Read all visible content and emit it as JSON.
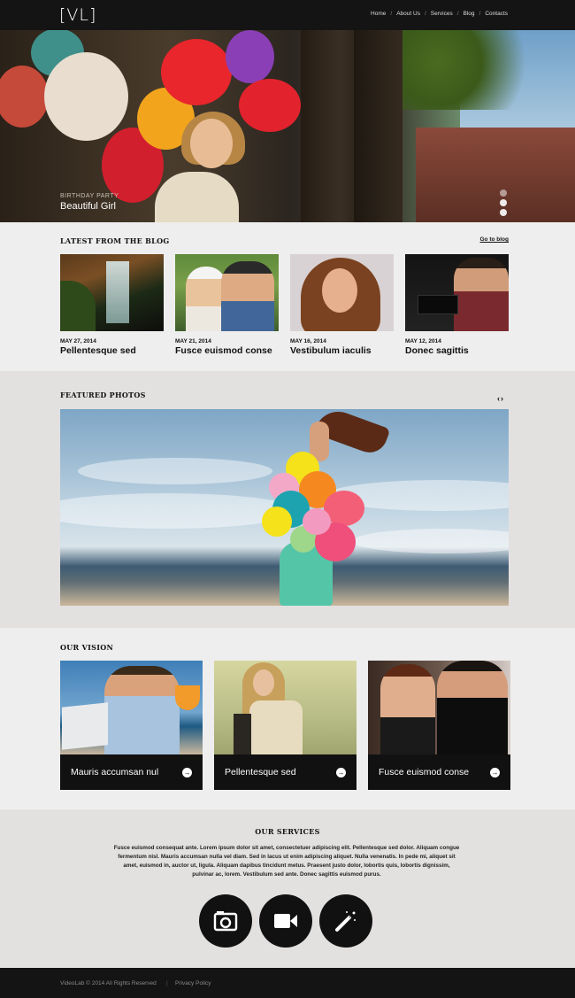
{
  "header": {
    "logo": "[VL]",
    "nav": [
      "Home",
      "About Us",
      "Services",
      "Blog",
      "Contacts"
    ]
  },
  "hero": {
    "caption_small": "BIRTHDAY PARTY",
    "caption_title": "Beautiful Girl",
    "slide_count": 3,
    "active_slide": 1
  },
  "blog": {
    "title": "LATEST FROM THE BLOG",
    "link": "Go to blog",
    "posts": [
      {
        "date": "MAY 27, 2014",
        "title": "Pellentesque sed"
      },
      {
        "date": "MAY 21, 2014",
        "title": "Fusce euismod conse"
      },
      {
        "date": "MAY 16, 2014",
        "title": "Vestibulum iaculis"
      },
      {
        "date": "MAY 12, 2014",
        "title": "Donec sagittis"
      }
    ]
  },
  "featured": {
    "title": "FEATURED PHOTOS",
    "prev": "‹",
    "next": "›"
  },
  "vision": {
    "title": "OUR VISION",
    "cards": [
      {
        "label": "Mauris accumsan nul"
      },
      {
        "label": "Pellentesque sed"
      },
      {
        "label": "Fusce euismod conse"
      }
    ]
  },
  "services": {
    "title": "OUR SERVICES",
    "text": "Fusce euismod consequat ante. Lorem ipsum dolor sit amet, consectetuer adipiscing elit. Pellentesque sed dolor. Aliquam congue fermentum nisl. Mauris accumsan nulla vel diam. Sed in lacus ut enim adipiscing aliquet. Nulla venenatis. In pede mi, aliquet sit amet, euismod in, auctor ut, ligula. Aliquam dapibus tincidunt metus. Praesent justo dolor, lobortis quis, lobortis dignissim, pulvinar ac, lorem. Vestibulum sed ante. Donec sagittis euismod purus.",
    "icons": [
      "photo-camera-icon",
      "video-camera-icon",
      "magic-wand-icon"
    ]
  },
  "footer": {
    "copyright": "VideoLab © 2014 All Rights Reserved",
    "separator": "|",
    "privacy": "Privacy Policy"
  }
}
